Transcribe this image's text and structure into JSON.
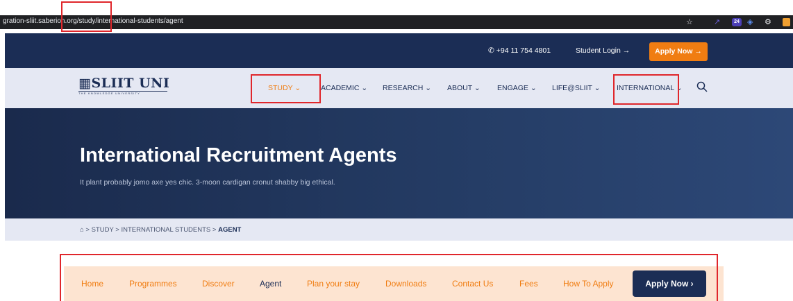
{
  "browser": {
    "url": "gration-sliit.saberion.org/study/international-students/agent",
    "icons": [
      "star-icon",
      "share-icon",
      "extension-badge-icon",
      "extension-icon",
      "extension-gear-icon",
      "profile-icon"
    ],
    "badge_count": "24"
  },
  "topbar": {
    "phone": "+94 11 754 4801",
    "student_login": "Student Login →",
    "apply_now": "Apply Now →"
  },
  "logo": {
    "name": "SLIIT UNI",
    "tagline": "THE KNOWLEDGE UNIVERSITY"
  },
  "nav": {
    "items": [
      {
        "label": "STUDY ⌄"
      },
      {
        "label": "ACADEMIC ⌄"
      },
      {
        "label": "RESEARCH ⌄"
      },
      {
        "label": "ABOUT ⌄"
      },
      {
        "label": "ENGAGE ⌄"
      },
      {
        "label": "LIFE@SLIIT ⌄"
      },
      {
        "label": "INTERNATIONAL ⌄"
      }
    ]
  },
  "hero": {
    "title": "International Recruitment Agents",
    "subtitle": "It plant probably jomo axe yes chic. 3-moon cardigan cronut shabby big ethical."
  },
  "breadcrumb": {
    "items": [
      "STUDY",
      "INTERNATIONAL STUDENTS"
    ],
    "current": "AGENT",
    "sep": ">"
  },
  "tabs": {
    "items": [
      {
        "label": "Home"
      },
      {
        "label": "Programmes"
      },
      {
        "label": "Discover"
      },
      {
        "label": "Agent"
      },
      {
        "label": "Plan your stay"
      },
      {
        "label": "Downloads"
      },
      {
        "label": "Contact Us"
      },
      {
        "label": "Fees"
      },
      {
        "label": "How To Apply"
      }
    ],
    "apply_now": "Apply Now  ›"
  },
  "colors": {
    "navy": "#1b2d55",
    "orange": "#f07d12",
    "peach": "#fde4d1",
    "annotation_red": "#e0262b"
  }
}
